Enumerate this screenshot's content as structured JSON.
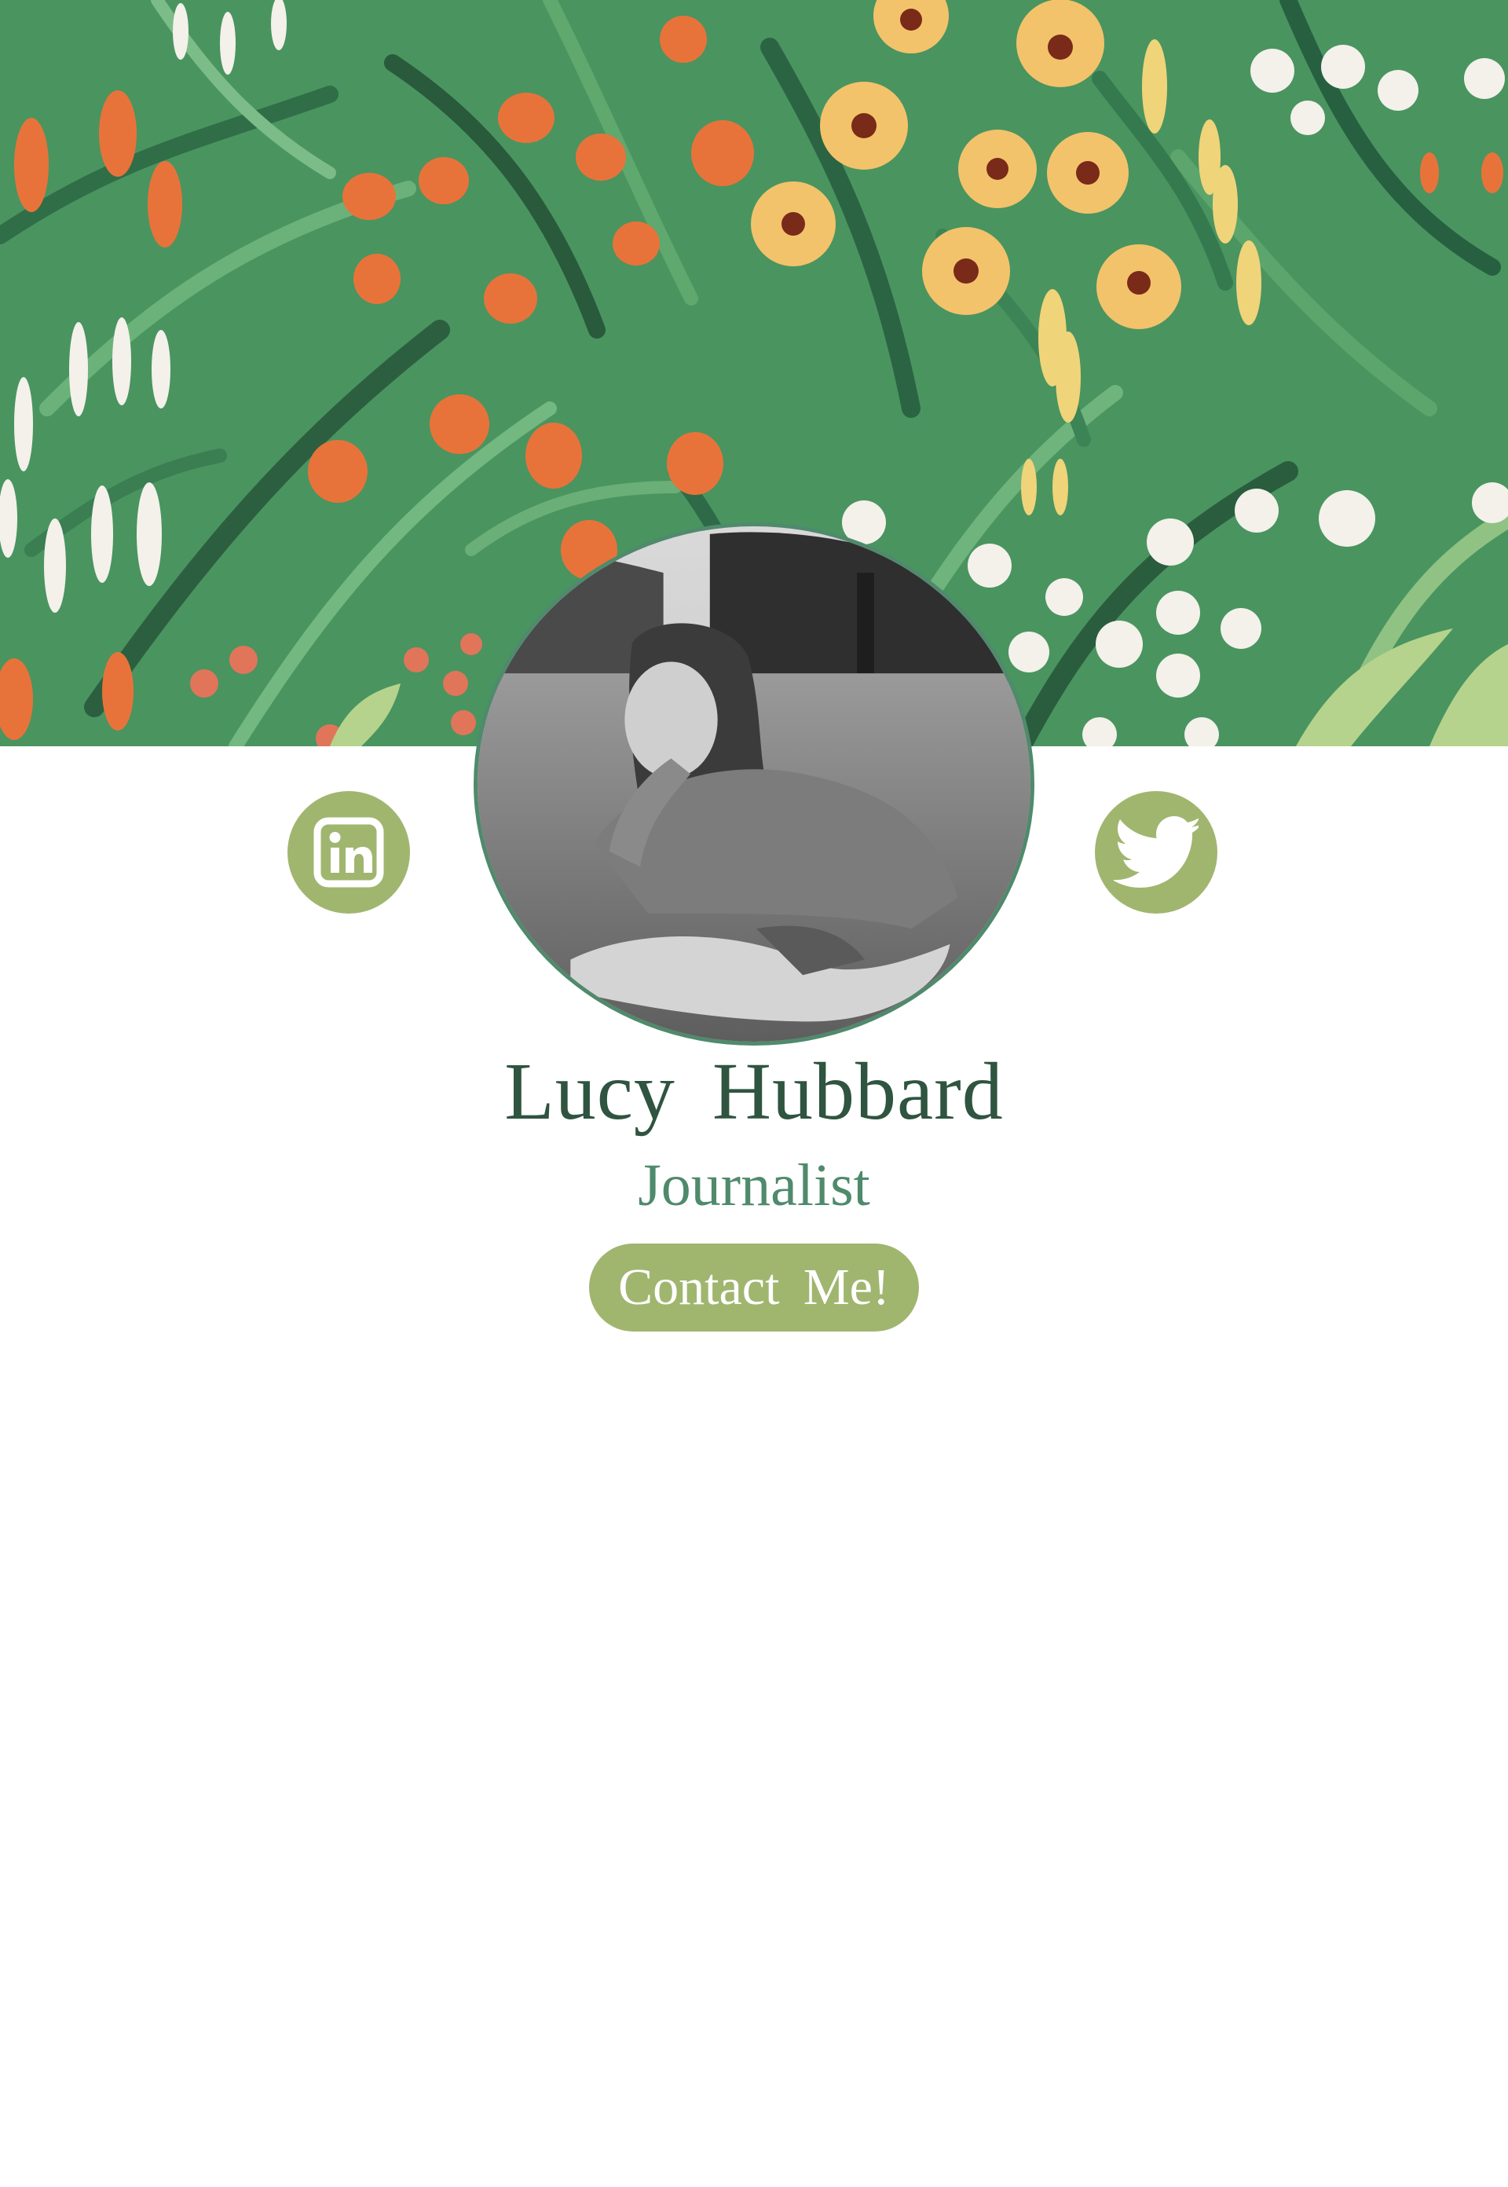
{
  "profile": {
    "name": "Lucy  Hubbard",
    "role": "Journalist",
    "contact_label": "Contact  Me!"
  },
  "social": [
    {
      "icon": "linkedin-icon"
    },
    {
      "icon": "twitter-icon"
    }
  ],
  "colors": {
    "accent": "#a0b66f",
    "name_text": "#2f5440",
    "role_text": "#4f8a6c",
    "avatar_border": "#4f8a6c",
    "background": "#ffffff"
  }
}
